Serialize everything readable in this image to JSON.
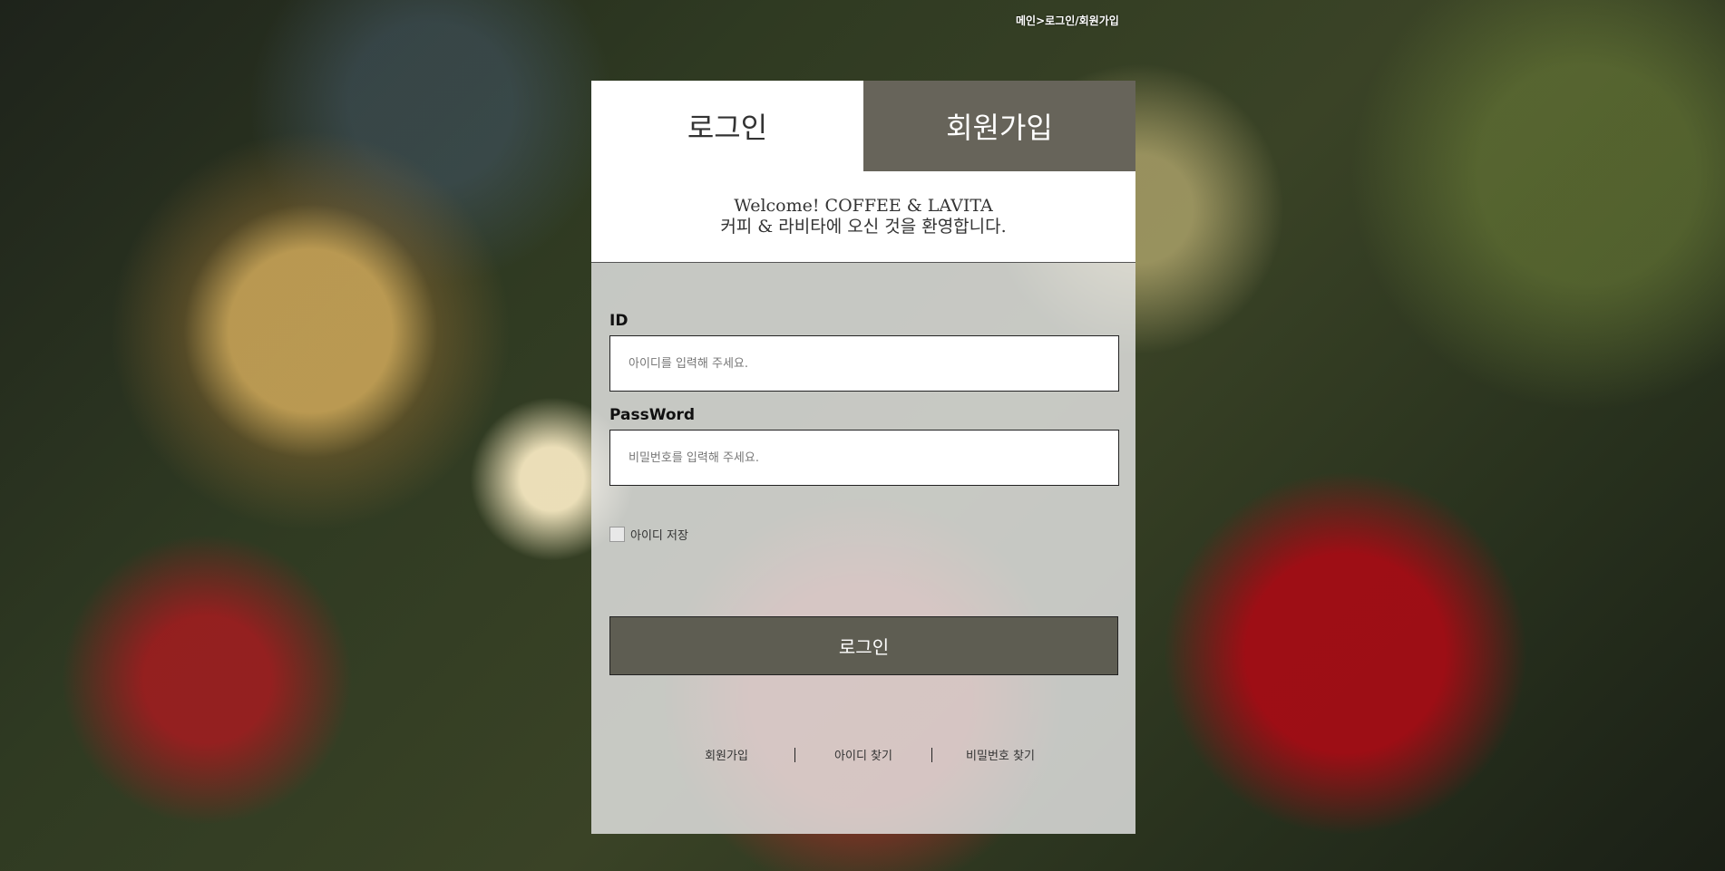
{
  "breadcrumb": "메인>로그인/회원가입",
  "tabs": {
    "login": "로그인",
    "signup": "회원가입"
  },
  "welcome": {
    "line1": "Welcome! COFFEE & LAVITA",
    "line2": "커피 & 라비타에 오신 것을 환영합니다."
  },
  "form": {
    "id_label": "ID",
    "id_placeholder": "아이디를 입력해 주세요.",
    "password_label": "PassWord",
    "password_placeholder": "비밀번호를 입력해 주세요.",
    "remember_label": "아이디 저장",
    "login_button": "로그인"
  },
  "links": {
    "signup": "회원가입",
    "find_id": "아이디 찾기",
    "find_password": "비밀번호 찾기"
  }
}
